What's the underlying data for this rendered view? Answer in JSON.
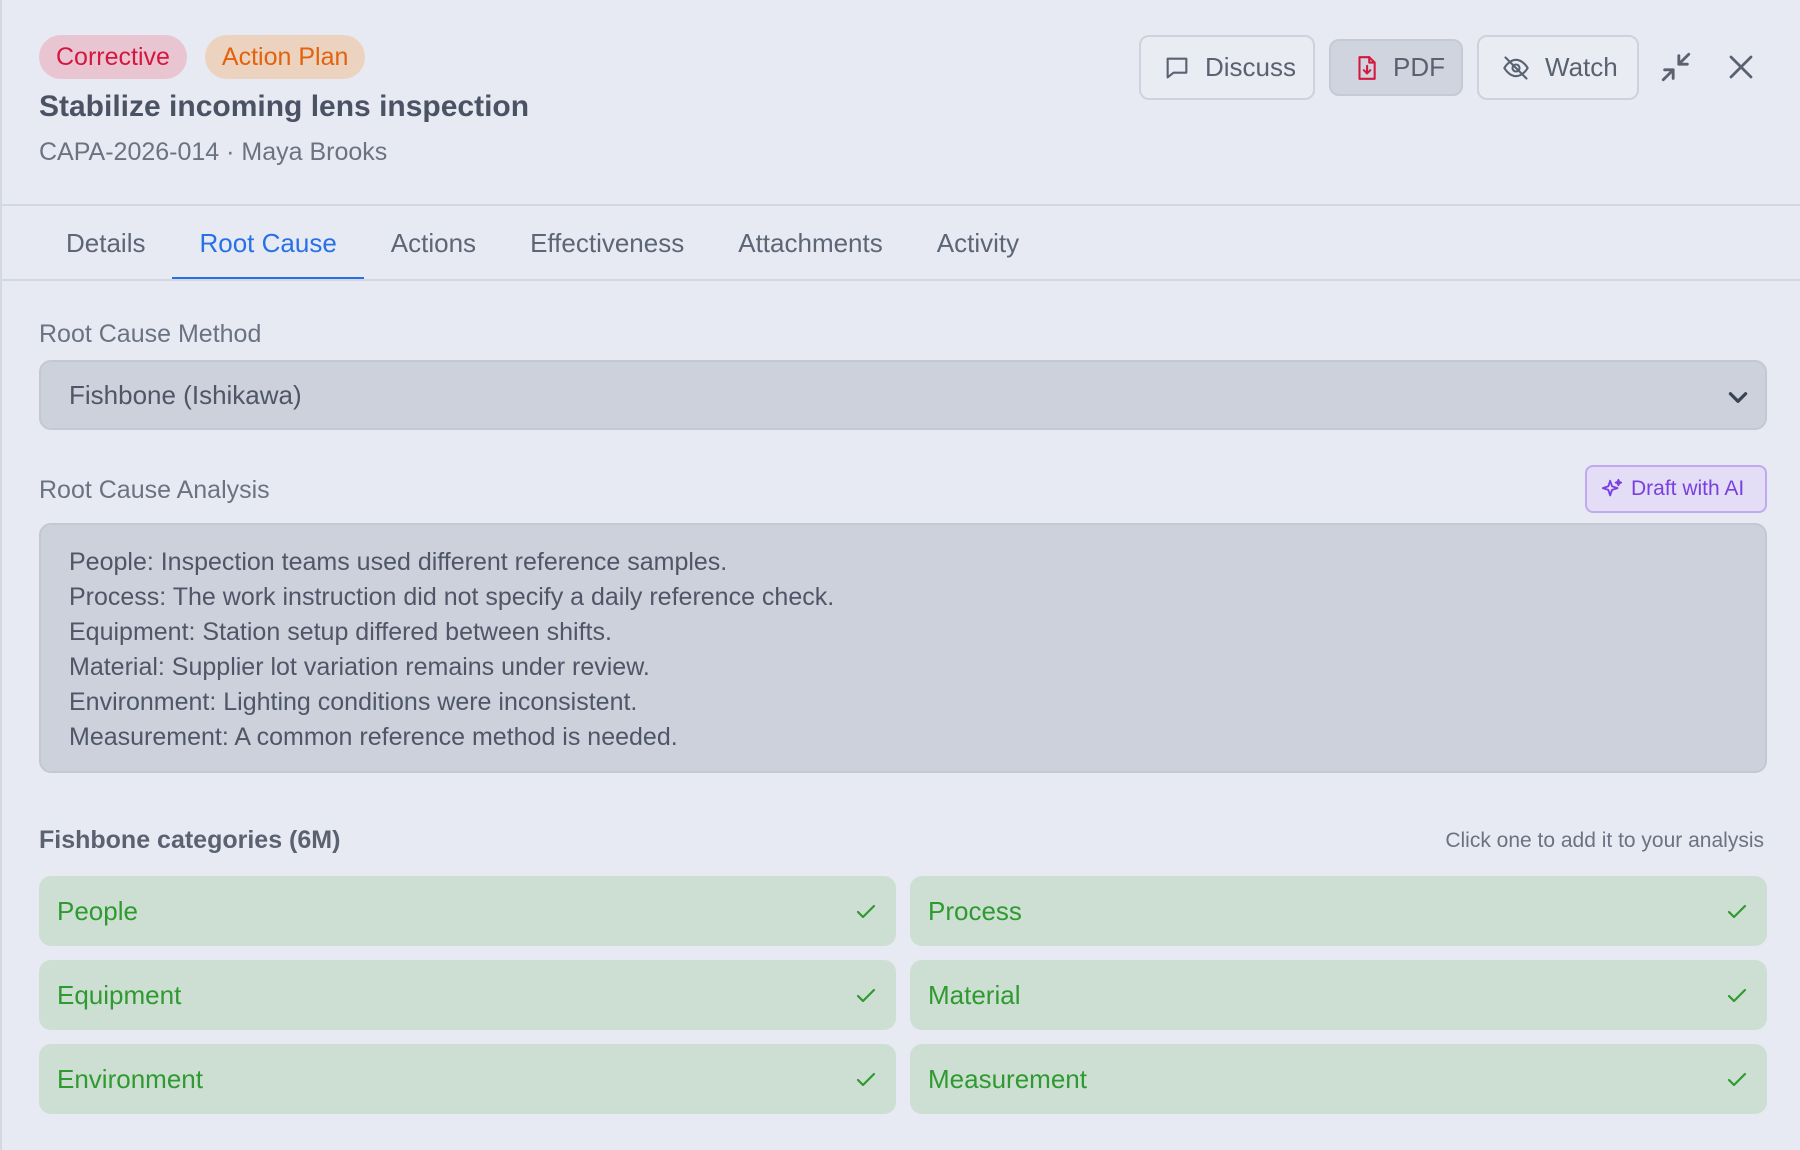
{
  "header": {
    "badges": [
      "Corrective",
      "Action Plan"
    ],
    "title": "Stabilize incoming lens inspection",
    "subtitle": "CAPA-2026-014 · Maya Brooks",
    "buttons": {
      "discuss": "Discuss",
      "pdf": "PDF",
      "watch": "Watch"
    }
  },
  "tabs": [
    {
      "label": "Details",
      "active": false
    },
    {
      "label": "Root Cause",
      "active": true
    },
    {
      "label": "Actions",
      "active": false
    },
    {
      "label": "Effectiveness",
      "active": false
    },
    {
      "label": "Attachments",
      "active": false
    },
    {
      "label": "Activity",
      "active": false
    }
  ],
  "root_cause": {
    "method_label": "Root Cause Method",
    "method_value": "Fishbone (Ishikawa)",
    "analysis_label": "Root Cause Analysis",
    "ai_button": "Draft with AI",
    "analysis_lines": [
      "People: Inspection teams used different reference samples.",
      "Process: The work instruction did not specify a daily reference check.",
      "Equipment: Station setup differed between shifts.",
      "Material: Supplier lot variation remains under review.",
      "Environment: Lighting conditions were inconsistent.",
      "Measurement: A common reference method is needed."
    ]
  },
  "fishbone": {
    "title": "Fishbone categories (6M)",
    "hint": "Click one to add it to your analysis",
    "categories": [
      {
        "label": "People",
        "checked": true
      },
      {
        "label": "Process",
        "checked": true
      },
      {
        "label": "Equipment",
        "checked": true
      },
      {
        "label": "Material",
        "checked": true
      },
      {
        "label": "Environment",
        "checked": true
      },
      {
        "label": "Measurement",
        "checked": true
      }
    ]
  },
  "colors": {
    "accent": "#2870e8",
    "corrective": "#d5173f",
    "action_plan": "#e2620d",
    "ai": "#7a3fe0",
    "success": "#2f9a2f"
  }
}
